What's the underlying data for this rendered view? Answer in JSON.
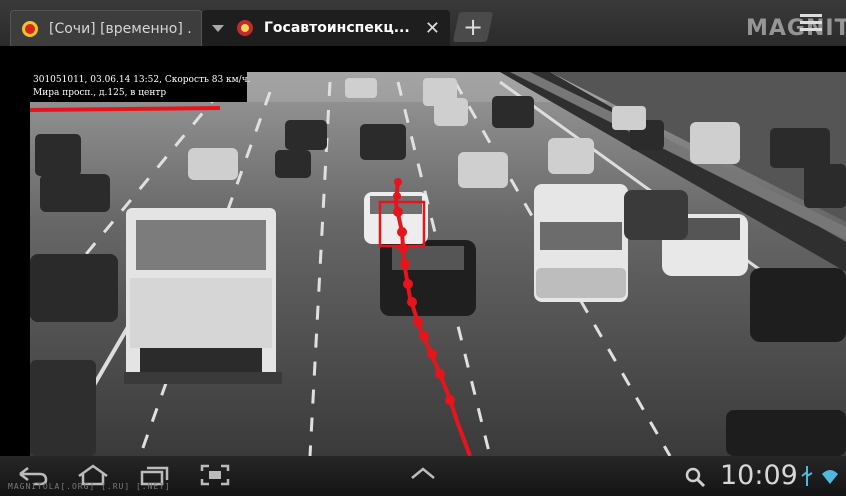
{
  "tabs": [
    {
      "title": "[Сочи] [временно] ...",
      "state": "inactive"
    },
    {
      "title": "Госавтоинспекц...",
      "state": "active",
      "close": "✕"
    }
  ],
  "new_tab_symbol": "+",
  "watermark_top": "MAGNITOL",
  "photo": {
    "caption_line1": "301051011, 03.06.14 13:52, Скорость 83 км/ч.",
    "caption_line2": "Мира просп., д.125, в центр"
  },
  "system_bar": {
    "clock": "10:09",
    "credit": "MAGNITOLA[.ORG] [.RU] [.NET]"
  },
  "colors": {
    "track": "#e8141b",
    "accent": "#e8141b"
  },
  "icons": [
    "back-icon",
    "home-icon",
    "recent-apps-icon",
    "screenshot-icon",
    "up-chevron-icon",
    "search-icon",
    "usb-icon",
    "wifi-icon"
  ]
}
